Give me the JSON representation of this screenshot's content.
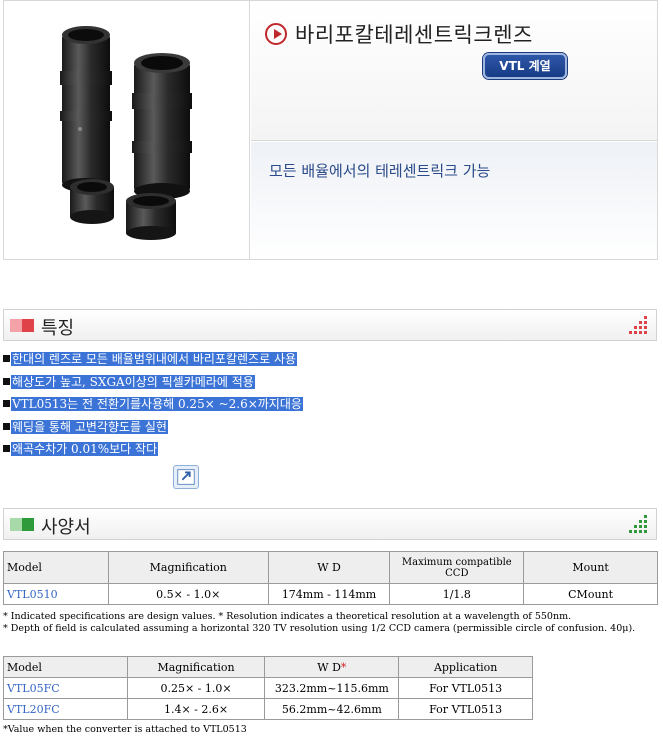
{
  "hero": {
    "title": "바리포칼테레센트릭크렌즈",
    "badge": "VTL 계열",
    "subtitle": "모든 배율에서의 테레센트릭크 가능"
  },
  "features_section": {
    "title": "특징",
    "items": [
      "한대의 렌즈로 모든 배율범위내에서 바리포칼렌즈로 사용",
      "해상도가 높고, SXGA이상의 픽셀카메라에 적용",
      "VTL0513는 전 전환기를사용해 0.25× ~2.6×까지대응",
      "웨딩을 통해 고변각향도를 실현",
      "왜곡수차가 0.01%보다 작다"
    ]
  },
  "spec_section": {
    "title": "사양서",
    "table1": {
      "headers": [
        "Model",
        "Magnification",
        "W D",
        "Maximum compatible CCD",
        "Mount"
      ],
      "rows": [
        [
          "VTL0510",
          "0.5× - 1.0×",
          "174mm - 114mm",
          "1/1.8",
          "CMount"
        ]
      ]
    },
    "notes1": [
      "* Indicated specifications are design values.    * Resolution indicates a theoretical resolution at a wavelength of 550nm.",
      "* Depth of field is calculated assuming a horizontal 320 TV resolution using 1/2 CCD camera (permissible circle of confusion. 40μ)."
    ],
    "table2": {
      "headers": [
        "Model",
        "Magnification",
        "W D",
        "Application"
      ],
      "wd_marker": "*",
      "rows": [
        [
          "VTL05FC",
          "0.25× - 1.0×",
          "323.2mm~115.6mm",
          "For VTL0513"
        ],
        [
          "VTL20FC",
          "1.4× - 2.6×",
          "56.2mm~42.6mm",
          "For VTL0513"
        ]
      ]
    },
    "note2": "*Value when the converter is attached to VTL0513"
  },
  "colors": {
    "accent_red": "#c0272d",
    "feature_marker_red": "#e0424a",
    "spec_marker_green": "#2f9a3a",
    "badge_blue": "#1f4694",
    "highlight_blue": "#3b73d6",
    "model_link": "#3565c5"
  },
  "icons": [
    "play-circle-icon",
    "dots-grid-icon",
    "expand-link-icon"
  ]
}
